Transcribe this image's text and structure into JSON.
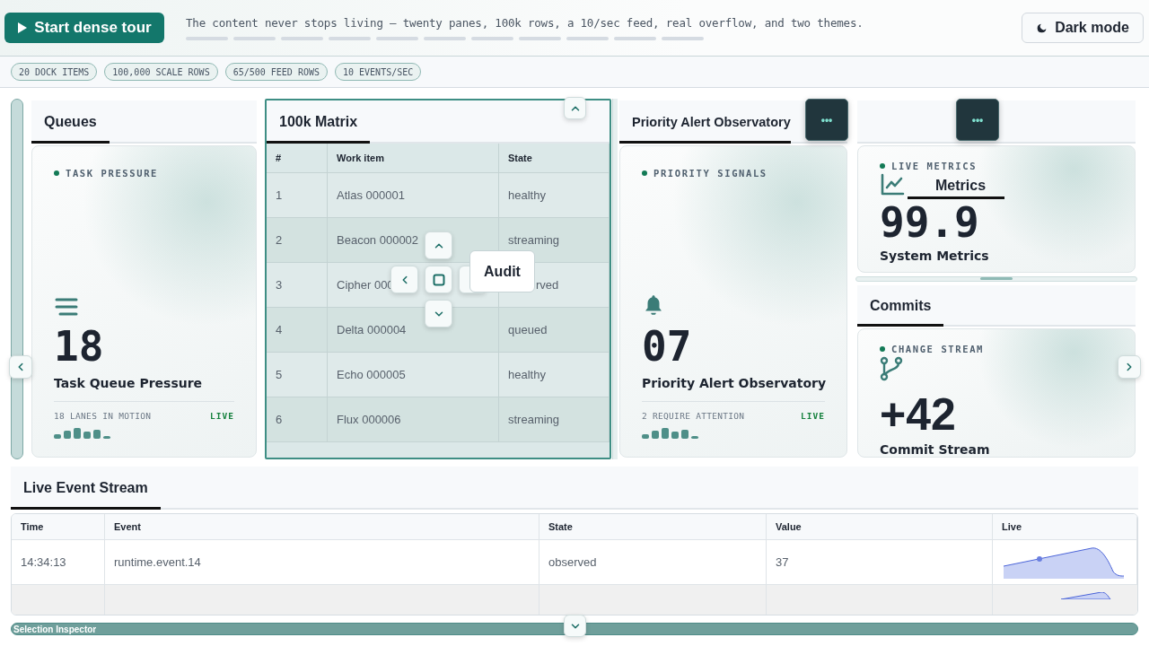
{
  "header": {
    "tour_button": "Start dense tour",
    "tagline": "The content never stops living — twenty panes, 100k rows, a 10/sec feed, real overflow, and two themes.",
    "theme_button": "Dark mode"
  },
  "chips": [
    "20 DOCK ITEMS",
    "100,000 SCALE ROWS",
    "65/500 FEED ROWS",
    "10 EVENTS/SEC"
  ],
  "dock_columns": [
    {
      "panes": [
        {
          "kind": "queue",
          "tab": "Queues",
          "selected": false,
          "eyebrow": "TASK PRESSURE",
          "value": "18",
          "title": "Task Queue Pressure",
          "footnote": "18 LANES IN MOTION",
          "status": "LIVE"
        }
      ]
    },
    {
      "panes": [
        {
          "kind": "matrix",
          "tab": "100k Matrix",
          "selected": true,
          "columns": [
            "#",
            "Work item",
            "State"
          ],
          "rows": [
            {
              "covered": false,
              "cells": [
                "1",
                "Atlas 000001",
                "healthy"
              ]
            },
            {
              "covered": false,
              "cells": [
                "2",
                "Beacon 000002",
                "streaming"
              ]
            },
            {
              "covered": true,
              "cells": [
                "3",
                "Cipher 000",
                "rved"
              ]
            },
            {
              "covered": false,
              "cells": [
                "4",
                "Delta 000004",
                "queued"
              ]
            },
            {
              "covered": false,
              "cells": [
                "5",
                "Echo 000005",
                "healthy"
              ]
            },
            {
              "covered": false,
              "cells": [
                "6",
                "Flux 000006",
                "streaming"
              ]
            }
          ]
        }
      ]
    },
    {
      "menu_button": "•••",
      "panes": [
        {
          "kind": "alert",
          "tab": "Priority Alert Observatory",
          "selected": false,
          "eyebrow": "PRIORITY SIGNALS",
          "value": "07",
          "title": "Priority Alert Observatory",
          "footnote": "2 REQUIRE ATTENTION",
          "status": "LIVE"
        }
      ]
    },
    {
      "menu_button": "•••",
      "panes": [
        {
          "kind": "metrics",
          "selected": false,
          "drag_label": "Metrics",
          "eyebrow": "LIVE METRICS",
          "value": "99.9",
          "title": "System Metrics"
        },
        {
          "kind": "commits",
          "tab": "Commits",
          "selected": false,
          "eyebrow": "CHANGE STREAM",
          "value": "+42",
          "title": "Commit Stream"
        }
      ]
    }
  ],
  "dock_tooltip": "Audit",
  "event_stream": {
    "tab": "Live Event Stream",
    "columns": [
      "Time",
      "Event",
      "State",
      "Value",
      "Live"
    ],
    "rows": [
      [
        "14:34:13",
        "runtime.event.14",
        "observed",
        "37"
      ]
    ]
  },
  "inspector": {
    "title": "Selection Inspector"
  }
}
